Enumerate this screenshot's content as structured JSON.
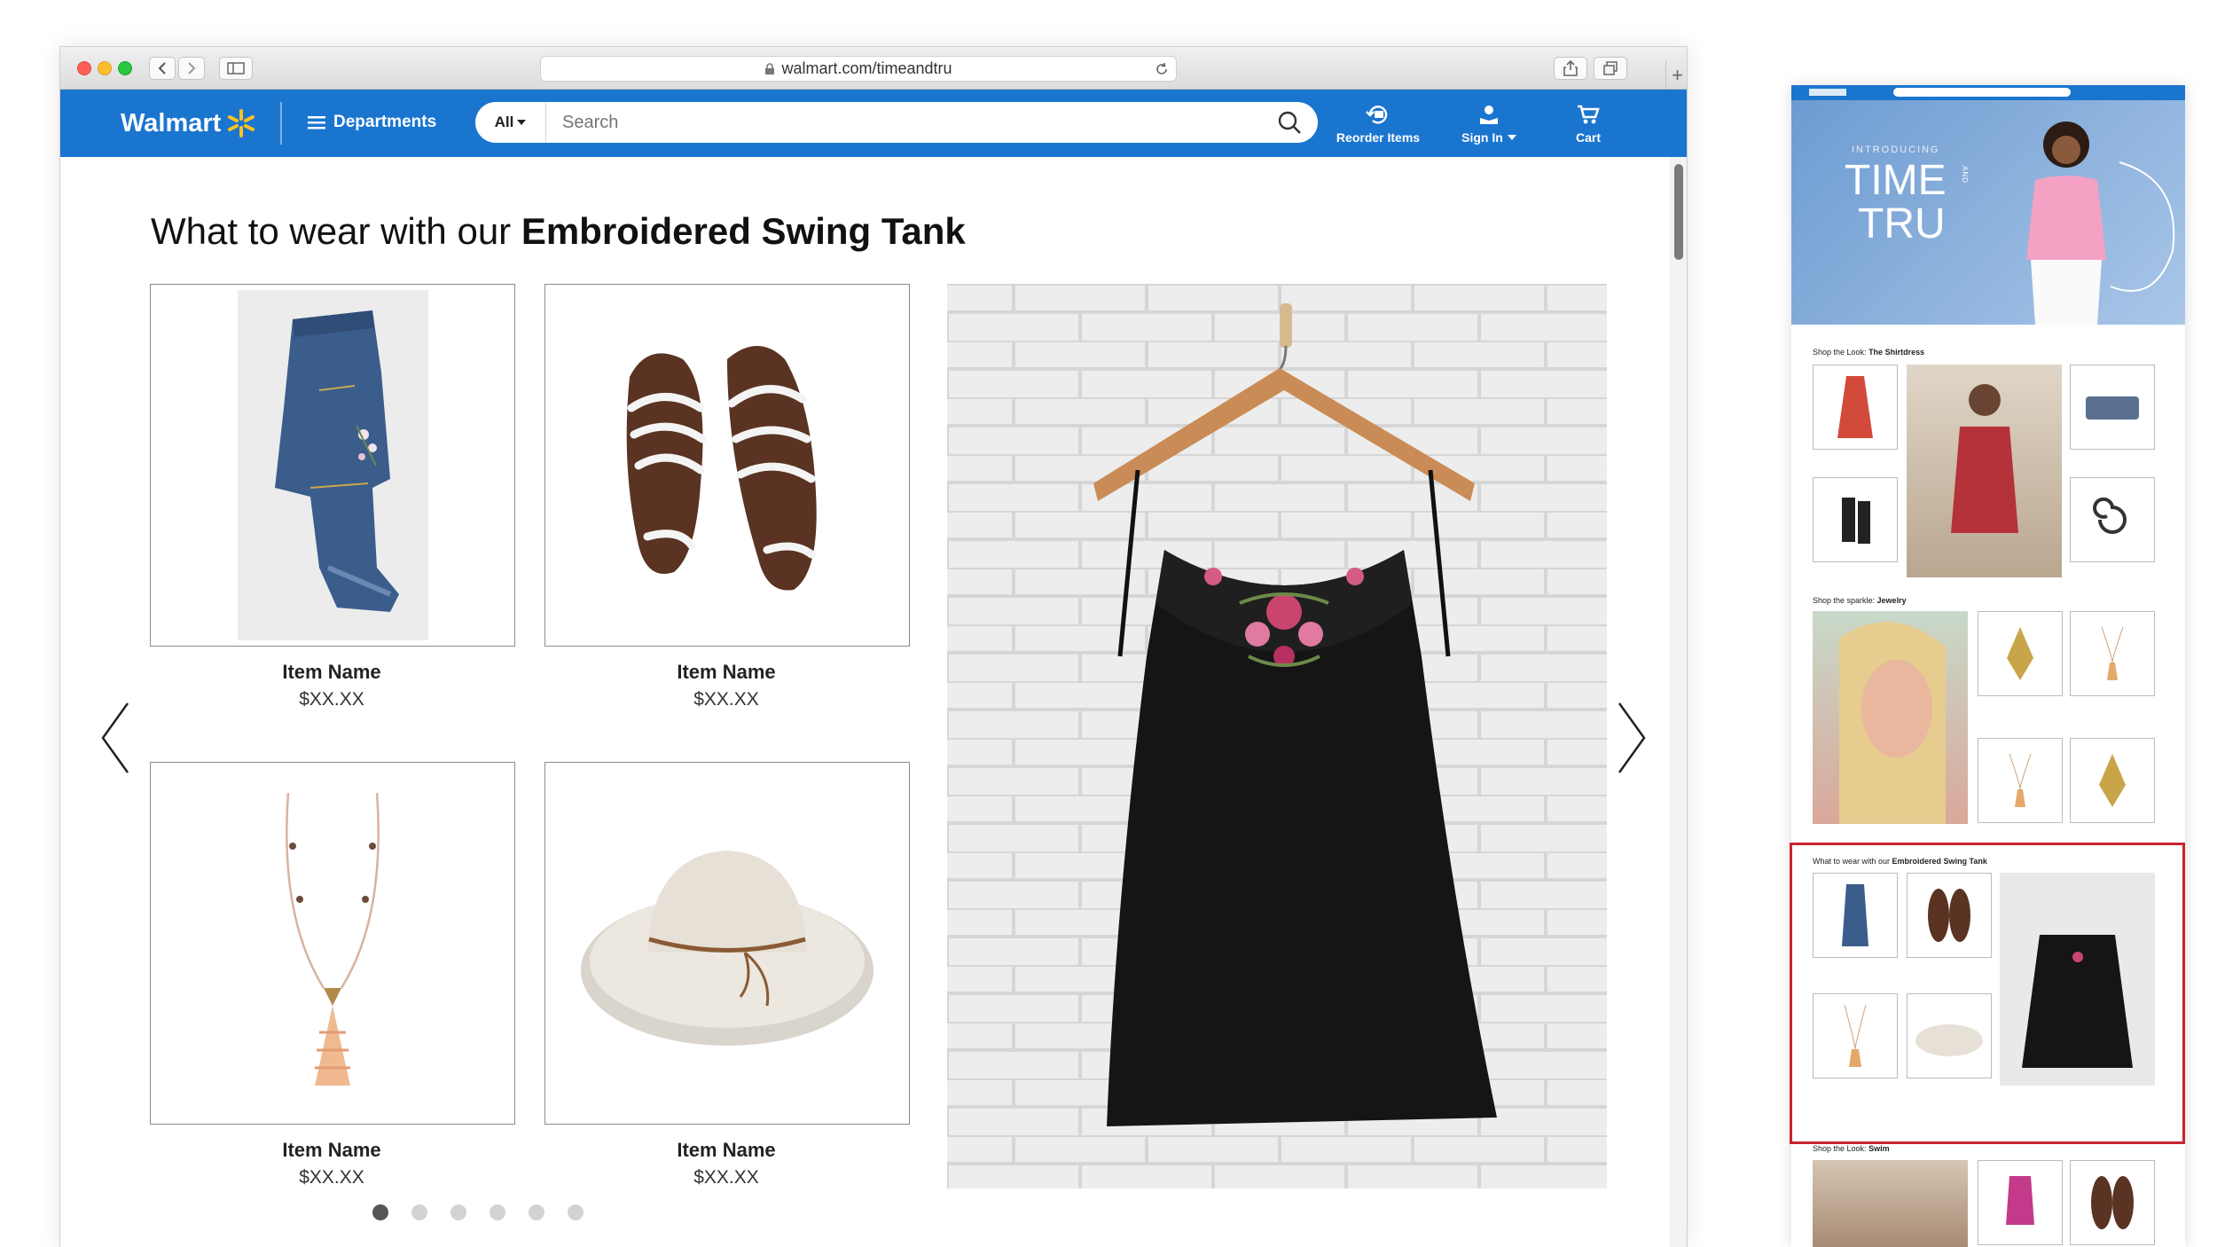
{
  "browser": {
    "url": "walmart.com/timeandtru"
  },
  "header": {
    "logo": "Walmart",
    "departments": "Departments",
    "search_scope": "All",
    "search_placeholder": "Search",
    "reorder": "Reorder Items",
    "sign_in": "Sign In",
    "cart": "Cart"
  },
  "section": {
    "title_prefix": "What to wear with our ",
    "title_bold": "Embroidered Swing Tank",
    "items": [
      {
        "name": "Item Name",
        "price": "$XX.XX",
        "icon": "jeans-image"
      },
      {
        "name": "Item Name",
        "price": "$XX.XX",
        "icon": "sandals-image"
      },
      {
        "name": "Item Name",
        "price": "$XX.XX",
        "icon": "necklace-image"
      },
      {
        "name": "Item Name",
        "price": "$XX.XX",
        "icon": "sun-hat-image"
      }
    ],
    "hero_icon": "swing-tank-on-hanger-image",
    "carousel": {
      "pages": 6,
      "active": 1
    }
  },
  "preview": {
    "hero_intro": "INTRODUCING",
    "hero_brand_1": "TIME",
    "hero_brand_and": "AND",
    "hero_brand_2": "TRU",
    "s1_prefix": "Shop the Look: ",
    "s1_bold": "The Shirtdress",
    "s2_prefix": "Shop the sparkle: ",
    "s2_bold": "Jewelry",
    "s3_prefix": "What to wear with our ",
    "s3_bold": "Embroidered Swing Tank",
    "s4_prefix": "Shop the Look: ",
    "s4_bold": "Swim",
    "tile_name": "Item Name",
    "tile_price": "$XX.XX"
  },
  "colors": {
    "walmart_blue": "#1a75cf",
    "spark_yellow": "#ffc220",
    "highlight_red": "#c8242f"
  }
}
